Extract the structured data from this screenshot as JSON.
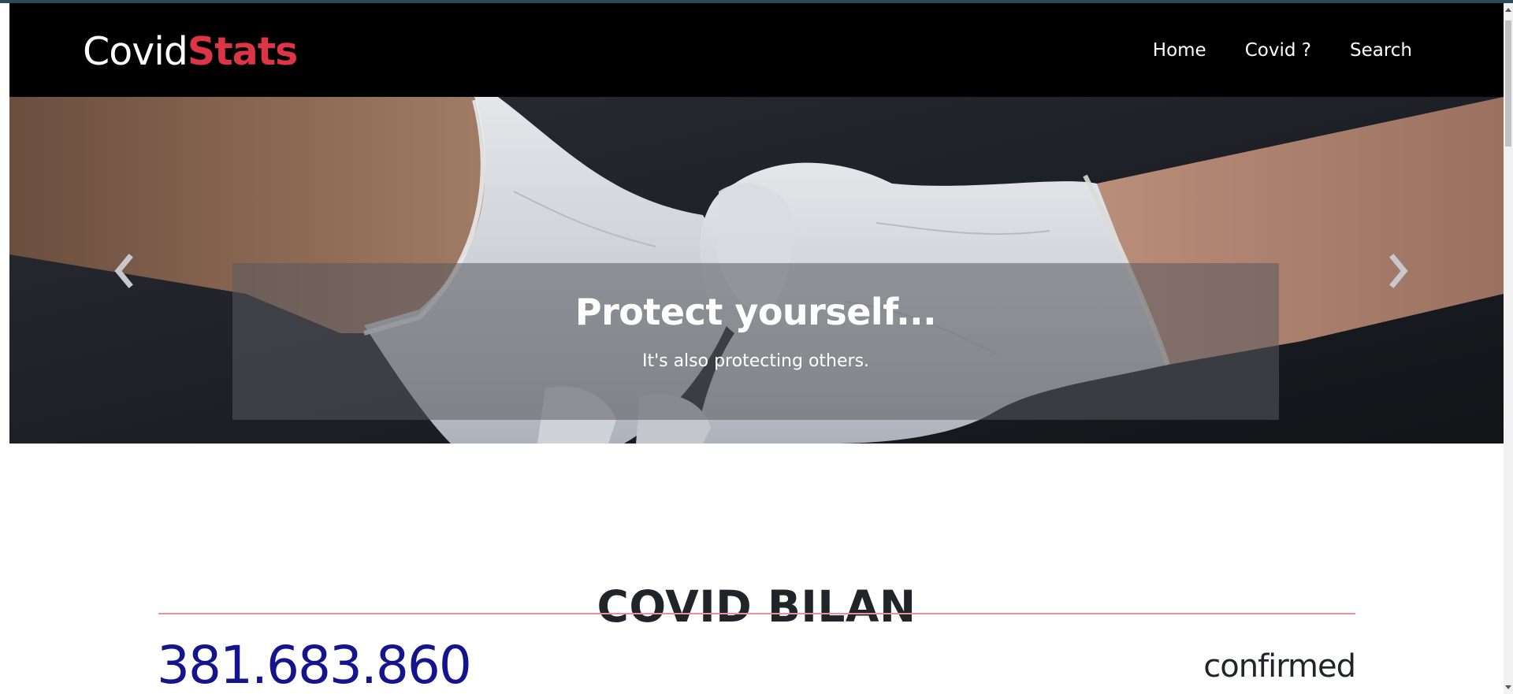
{
  "navbar": {
    "brand": {
      "part1": "Covid",
      "part2": "Stats"
    },
    "links": [
      {
        "label": "Home"
      },
      {
        "label": "Covid ?"
      },
      {
        "label": "Search"
      }
    ]
  },
  "hero": {
    "caption_title": "Protect yourself...",
    "caption_subtitle": "It's also protecting others.",
    "prev_icon": "chevron-left-icon",
    "next_icon": "chevron-right-icon"
  },
  "bilan": {
    "title": "COVID BILAN",
    "stat_value": "381.683.860",
    "stat_label": "confirmed"
  },
  "colors": {
    "brand_accent": "#dc3545",
    "stat_value": "#14148c",
    "divider": "#e8919a",
    "navbar_bg": "#000000"
  }
}
